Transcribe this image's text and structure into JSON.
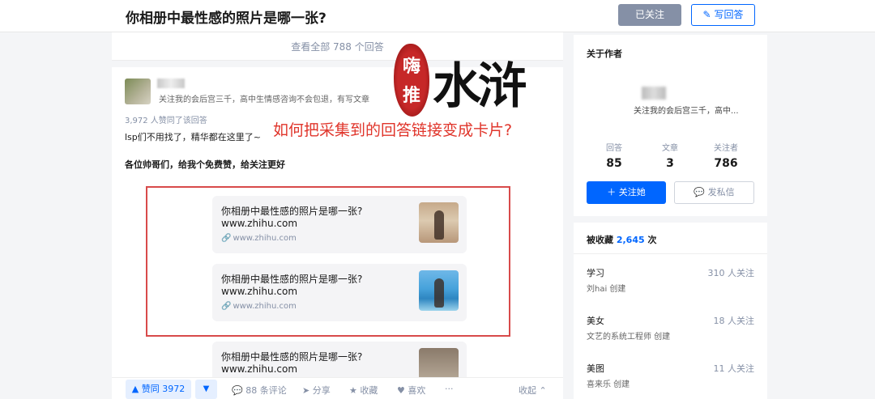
{
  "header": {
    "question_title": "你相册中最性感的照片是哪一张?",
    "followed_label": "已关注",
    "write_answer_label": "写回答",
    "write_icon": "pencil-icon"
  },
  "answers_bar": {
    "view_all": "查看全部 788 个回答"
  },
  "answer": {
    "author_bio": "关注我的会后宫三千，高中生情感咨询不会包退，有写文章",
    "vote_line": "3,972 人赞同了该回答",
    "text_line1": "lsp们不用找了，精华都在这里了~",
    "text_line2": "各位帅哥们，给我个免费赞，给关注更好",
    "link_cards": [
      {
        "title": "你相册中最性感的照片是哪一张?",
        "domain": "www.zhihu.com",
        "sub": "www.zhihu.com"
      },
      {
        "title": "你相册中最性感的照片是哪一张?",
        "domain": "www.zhihu.com",
        "sub": "www.zhihu.com"
      },
      {
        "title": "你相册中最性感的照片是哪一张?",
        "domain": "www.zhihu.com",
        "sub": ""
      }
    ]
  },
  "actions": {
    "upvote": "▲ 赞同 3972",
    "downvote": "▼",
    "comments": "88 条评论",
    "share": "分享",
    "favorite": "收藏",
    "like": "喜欢",
    "more": "···",
    "collapse": "收起"
  },
  "overlay": {
    "caption": "如何把采集到的回答链接变成卡片?",
    "seal_chars": [
      "嗨",
      "推"
    ],
    "brush_title": "水浒"
  },
  "sidebar": {
    "about_title": "关于作者",
    "author_bio": "关注我的会后宫三千，高中...",
    "stats": [
      {
        "label": "回答",
        "value": "85"
      },
      {
        "label": "文章",
        "value": "3"
      },
      {
        "label": "关注者",
        "value": "786"
      }
    ],
    "follow_her": "关注她",
    "message": "发私信",
    "collected_prefix": "被收藏",
    "collected_count": "2,645",
    "collected_suffix": "次",
    "collections": [
      {
        "name": "学习",
        "creator": "刘hai 创建",
        "count": "310 人关注"
      },
      {
        "name": "美女",
        "creator": "文艺的系统工程师 创建",
        "count": "18 人关注"
      },
      {
        "name": "美图",
        "creator": "喜来乐 创建",
        "count": "11 人关注"
      }
    ]
  },
  "colors": {
    "brand_blue": "#0066ff",
    "highlight_red": "#e0352b",
    "frame_red": "#d84a4a"
  }
}
